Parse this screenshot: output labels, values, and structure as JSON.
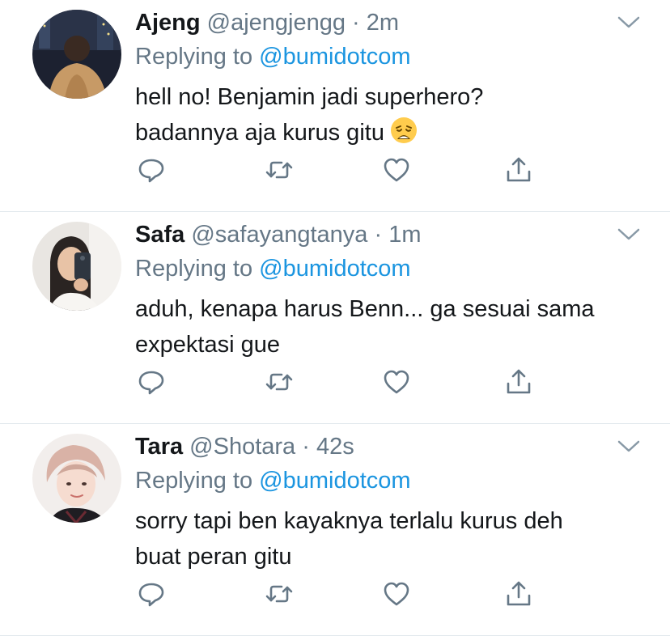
{
  "replies": [
    {
      "name": "Ajeng",
      "handle": "@ajengjengg",
      "dot": "·",
      "time": "2m",
      "replying_prefix": "Replying to ",
      "replying_to": "@bumidotcom",
      "text_line1": "hell no! Benjamin jadi superhero?",
      "text_line2": "badannya aja kurus gitu",
      "emoji": "weary-face-emoji"
    },
    {
      "name": "Safa",
      "handle": "@safayangtanya",
      "dot": "·",
      "time": "1m",
      "replying_prefix": "Replying to ",
      "replying_to": "@bumidotcom",
      "text_line1": "aduh, kenapa harus Benn... ga sesuai sama",
      "text_line2": "expektasi gue"
    },
    {
      "name": "Tara",
      "handle": "@Shotara",
      "dot": "·",
      "time": "42s",
      "replying_prefix": "Replying to ",
      "replying_to": "@bumidotcom",
      "text_line1": "sorry tapi ben kayaknya terlalu kurus deh",
      "text_line2": "buat peran gitu"
    }
  ],
  "colors": {
    "text": "#14171a",
    "secondary": "#657786",
    "link": "#1b95e0",
    "divider": "#e1e8ed"
  },
  "icons": [
    "comment-icon",
    "retweet-icon",
    "like-icon",
    "share-icon",
    "chevron-down-icon"
  ]
}
